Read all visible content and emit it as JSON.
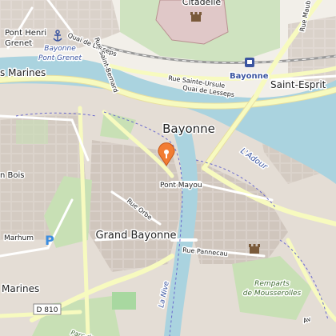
{
  "map": {
    "labels": {
      "citadelle": "Citadelle",
      "pont_henri": "Pont Henri",
      "grenet": "Grenet",
      "bayonne_pont_grenet_1": "Bayonne",
      "bayonne_pont_grenet_2": "Pont Grenet",
      "rue_maubec": "Rue Maub",
      "quai_lesseps_top": "Quai de Lesseps",
      "rue_st_bernard": "Rue Saint-Bernard",
      "rue_ste_ursule": "Rue Sainte-Ursule",
      "quai_lesseps_bottom": "Quai de Lesseps",
      "bayonne_station": "Bayonne",
      "saint_esprit": "Saint-Esprit",
      "marines": "s Marines",
      "bayonne_city": "Bayonne",
      "ladour": "L'Adour",
      "pont_mayou": "Pont Mayou",
      "bois": "n Bois",
      "rue_orbe": "Rue Orbe",
      "grand_bayonne": "Grand Bayonne",
      "marhum": "Marhum",
      "rue_pannecau": "Rue Pannecau",
      "remparts_1": "Remparts",
      "remparts_2": "de Mousserolles",
      "la_nive": "La Nive",
      "marines_bottom": "Marines",
      "d810": "D 810",
      "parc_des": "Parc des",
      "av": "Av"
    },
    "icons": [
      "marker-icon",
      "anchor-icon",
      "parking-icon",
      "castle-icon",
      "station-icon"
    ],
    "colors": {
      "land": "#f2efe9",
      "water": "#aad3df",
      "built": "#d9d0c9",
      "buildings": "#d0c6bd",
      "park": "#c8e0b5",
      "primary_road": "#f7fabf",
      "secondary_road": "#ffffff",
      "marker": "#f27c33"
    }
  }
}
